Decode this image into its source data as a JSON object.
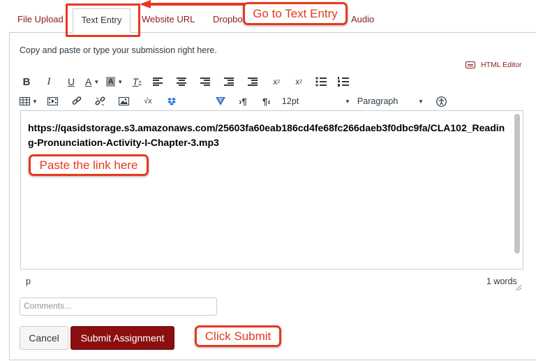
{
  "tabs": {
    "file_upload": "File Upload",
    "text_entry": "Text Entry",
    "website_url": "Website URL",
    "dropbox": "Dropbo",
    "audio": "Audio"
  },
  "instructions": "Copy and paste or type your submission right here.",
  "html_editor_label": "HTML Editor",
  "toolbar": {
    "font_size": "12pt",
    "block_format": "Paragraph"
  },
  "editor": {
    "content": "https://qasidstorage.s3.amazonaws.com/25603fa60eab186cd4fe68fc266daeb3f0dbc9fa/CLA102_Reading-Pronunciation-Activity-I-Chapter-3.mp3",
    "path": "p",
    "word_count": "1 words"
  },
  "comments_placeholder": "Comments...",
  "buttons": {
    "cancel": "Cancel",
    "submit": "Submit Assignment"
  },
  "annotations": {
    "go_to_text_entry": "Go to Text Entry",
    "paste_link": "Paste the link here",
    "click_submit": "Click Submit",
    "color": "#e8381e"
  },
  "colors": {
    "link": "#8b1a1a",
    "submit_bg": "#8b0f0f",
    "border": "#c7cdd1"
  }
}
